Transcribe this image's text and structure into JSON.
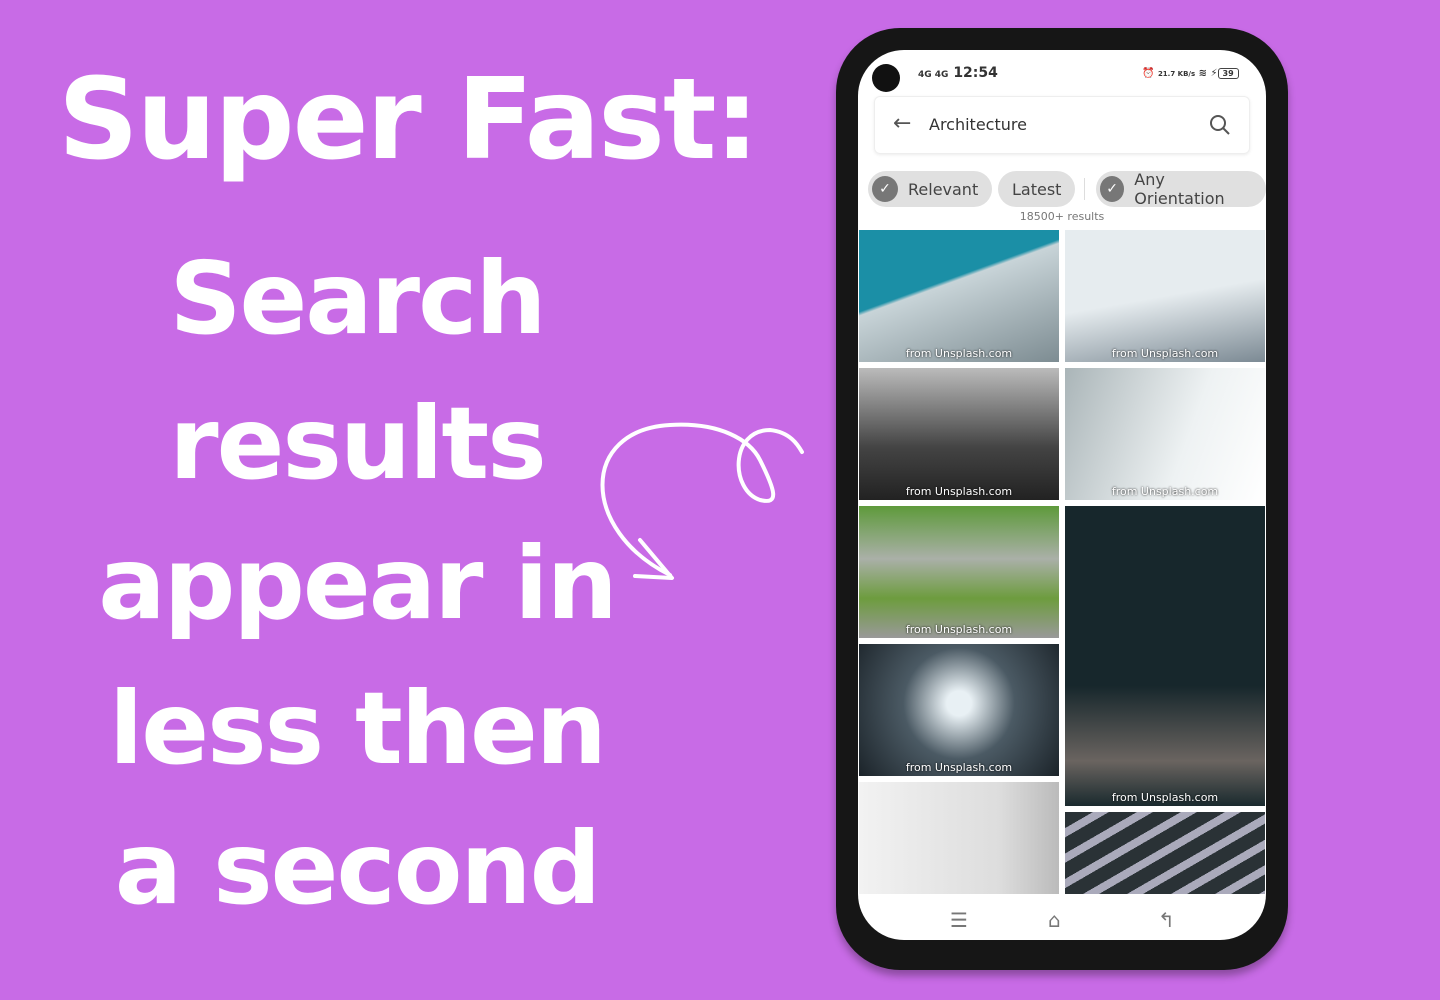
{
  "headline": {
    "line1": "Super Fast:",
    "lines": [
      "Search",
      "results",
      "appear in",
      "less then",
      "a second"
    ]
  },
  "colors": {
    "background": "#c86be6",
    "chip": "#e0e0e0"
  },
  "status_bar": {
    "network": "4G 4G",
    "time": "12:54",
    "speed": "21.7 KB/s",
    "battery": "39"
  },
  "search": {
    "query": "Architecture",
    "back_icon": "arrow-left-icon",
    "search_icon": "search-icon"
  },
  "filters": [
    {
      "label": "Relevant",
      "checked": true
    },
    {
      "label": "Latest",
      "checked": false
    },
    {
      "label": "Any Orientation",
      "checked": true
    }
  ],
  "results_count": "18500+ results",
  "images": [
    {
      "caption": "from Unsplash.com"
    },
    {
      "caption": "from Unsplash.com"
    },
    {
      "caption": "from Unsplash.com"
    },
    {
      "caption": "from Unsplash.com"
    },
    {
      "caption": "from Unsplash.com"
    },
    {
      "caption": "from Unsplash.com"
    },
    {
      "caption": "from Unsplash.com"
    },
    {
      "caption": ""
    },
    {
      "caption": ""
    }
  ],
  "nav_bar": [
    "menu-icon",
    "home-icon",
    "back-icon"
  ]
}
